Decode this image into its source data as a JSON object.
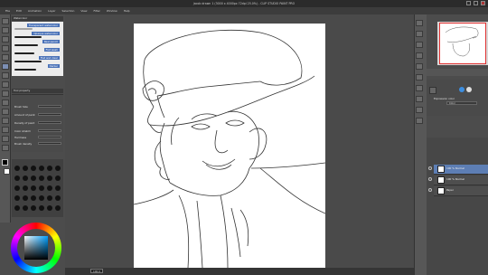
{
  "titlebar": {
    "title": "jacob drawn 1 (3000 x 4000px 72dpi 25.0%) - CLIP STUDIO PAINT PRO"
  },
  "menu": [
    "File",
    "Edit",
    "Animation",
    "Layer",
    "Selection",
    "View",
    "Filter",
    "Window",
    "Help"
  ],
  "brushes": [
    "Transparent watercolor",
    "Opaque watercolor",
    "Real pencil",
    "Flat wash",
    "Flat and clear",
    "Darker"
  ],
  "brush_panel_title": "Watercolor",
  "properties": {
    "title": "Tool property",
    "rows": [
      "Brush Size",
      "Amount of paint",
      "Density of paint",
      "Color stretch",
      "Hardness",
      "Brush density"
    ]
  },
  "statusbar": {
    "zoom": "100.0"
  },
  "layer_property": {
    "label": "Expression color",
    "value": "Color"
  },
  "layers": [
    {
      "name": "100 % Normal",
      "selected": true
    },
    {
      "name": "100 % Normal",
      "selected": false
    },
    {
      "name": "Paper",
      "selected": false
    }
  ],
  "colors": {
    "accent": "#4a72b8",
    "selection": "#5d7eb4",
    "nav_frame": "#e03030"
  }
}
